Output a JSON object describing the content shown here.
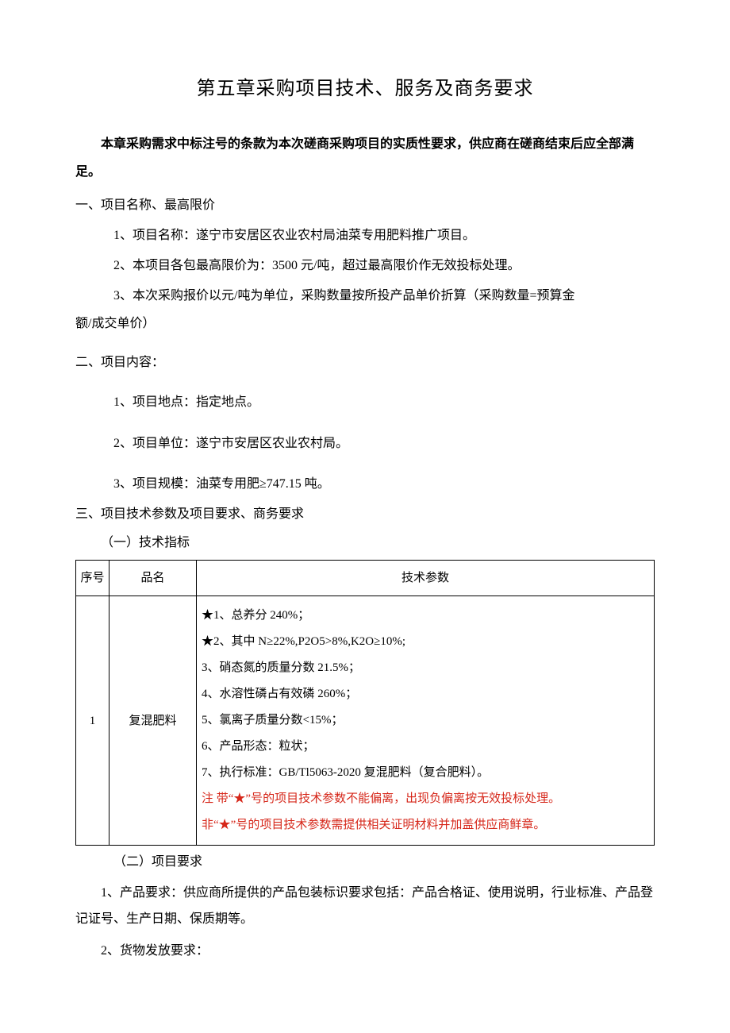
{
  "title": "第五章采购项目技术、服务及商务要求",
  "intro": "本章采购需求中标注号的条款为本次磋商采购项目的实质性要求，供应商在磋商结束后应全部满足。",
  "section1": {
    "heading": "一、项目名称、最高限价",
    "i1": "1、项目名称：遂宁市安居区农业农村局油菜专用肥料推广项目。",
    "i2": "2、本项目各包最高限价为：3500 元/吨，超过最高限价作无效投标处理。",
    "i3a": "3、本次采购报价以元/吨为单位，采购数量按所投产品单价折算（采购数量=预算金",
    "i3b": "额/成交单价）"
  },
  "section2": {
    "heading": "二、项目内容：",
    "i1": "1、项目地点：指定地点。",
    "i2": "2、项目单位：遂宁市安居区农业农村局。",
    "i3": "3、项目规模：油菜专用肥≥747.15 吨。"
  },
  "section3": {
    "heading": "三、项目技术参数及项目要求、商务要求",
    "sub1": "（一）技术指标",
    "table": {
      "h_seq": "序号",
      "h_name": "品名",
      "h_param": "技术参数",
      "row": {
        "seq": "1",
        "name": "复混肥料",
        "p1": "★1、总养分 240%；",
        "p2": "★2、其中 N≥22%,P2O5>8%,K2O≥10%;",
        "p3": "3、硝态氮的质量分数 21.5%；",
        "p4": "4、水溶性磷占有效磷 260%；",
        "p5": "5、氯离子质量分数<15%；",
        "p6": "6、产品形态：粒状；",
        "p7": "7、执行标准：GB/Tl5063-2020 复混肥料（复合肥料）。",
        "note1": "注 带“★”号的项目技术参数不能偏离，出现负偏离按无效投标处理。",
        "note2": "非“★”号的项目技术参数需提供相关证明材料并加盖供应商鲜章。"
      }
    },
    "sub2": "（二）项目要求",
    "req1": "1、产品要求：供应商所提供的产品包装标识要求包括：产品合格证、使用说明，行业标准、产品登记证号、生产日期、保质期等。",
    "req2": "2、货物发放要求："
  }
}
